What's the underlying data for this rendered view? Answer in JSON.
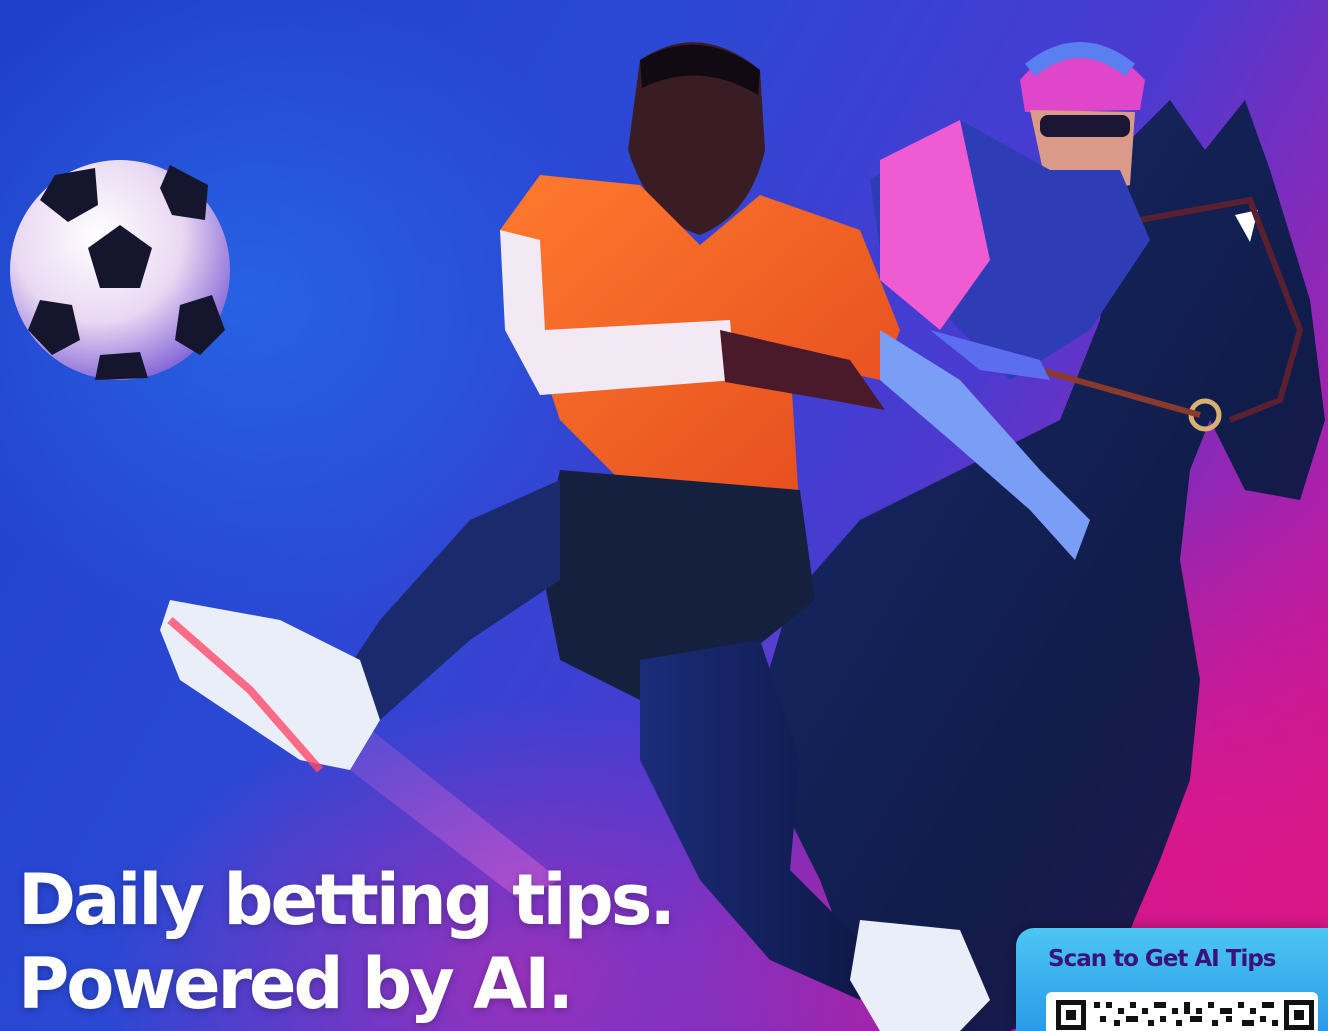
{
  "headline": {
    "line1": "Daily betting tips.",
    "line2": "Powered by AI."
  },
  "qr_card": {
    "title": "Scan to Get AI Tips",
    "qr_icon": "qr-code-icon"
  },
  "colors": {
    "background_blue": "#2a48d4",
    "background_magenta": "#d8177f",
    "card_blue": "#3fb3ef",
    "card_title_purple": "#3a1378",
    "headline_white": "#ffffff"
  }
}
